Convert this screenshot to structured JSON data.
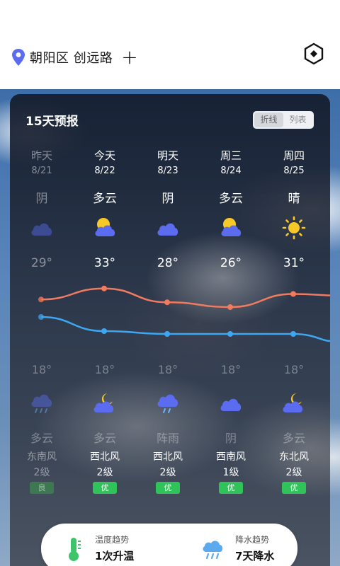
{
  "header": {
    "location": "朝阳区 创远路",
    "add_symbol": "+"
  },
  "forecast": {
    "title": "15天预报",
    "toggle": [
      "折线",
      "列表"
    ],
    "days": [
      {
        "name": "昨天",
        "date": "8/21",
        "weather": "阴",
        "high": "29°",
        "low": "18°",
        "night_weather": "多云",
        "wind_dir": "东南风",
        "wind_level": "2级",
        "aqi": "良",
        "day_icon": "overcast-cloud-icon",
        "night_icon": "rain-cloud-icon",
        "past": true
      },
      {
        "name": "今天",
        "date": "8/22",
        "weather": "多云",
        "high": "33°",
        "low": "18°",
        "night_weather": "多云",
        "wind_dir": "西北风",
        "wind_level": "2级",
        "aqi": "优",
        "day_icon": "partly-cloudy-icon",
        "night_icon": "moon-cloud-icon"
      },
      {
        "name": "明天",
        "date": "8/23",
        "weather": "阴",
        "high": "28°",
        "low": "18°",
        "night_weather": "阵雨",
        "wind_dir": "西北风",
        "wind_level": "2级",
        "aqi": "优",
        "day_icon": "overcast-cloud-icon",
        "night_icon": "rain-cloud-icon"
      },
      {
        "name": "周三",
        "date": "8/24",
        "weather": "多云",
        "high": "26°",
        "low": "18°",
        "night_weather": "阴",
        "wind_dir": "西南风",
        "wind_level": "1级",
        "aqi": "优",
        "day_icon": "partly-cloudy-icon",
        "night_icon": "overcast-cloud-icon"
      },
      {
        "name": "周四",
        "date": "8/25",
        "weather": "晴",
        "high": "31°",
        "low": "18°",
        "night_weather": "多云",
        "wind_dir": "东北风",
        "wind_level": "2级",
        "aqi": "优",
        "day_icon": "sun-icon",
        "night_icon": "moon-cloud-icon"
      }
    ]
  },
  "trends": {
    "temp_label": "温度趋势",
    "temp_value": "1次升温",
    "rain_label": "降水趋势",
    "rain_value": "7天降水"
  },
  "colors": {
    "high_line": "#f27a5e",
    "low_line": "#3ea7f2",
    "aqi_good": "#2fc35a",
    "cloud_blue": "#5b6cf0",
    "sun_yellow": "#f7c928"
  }
}
